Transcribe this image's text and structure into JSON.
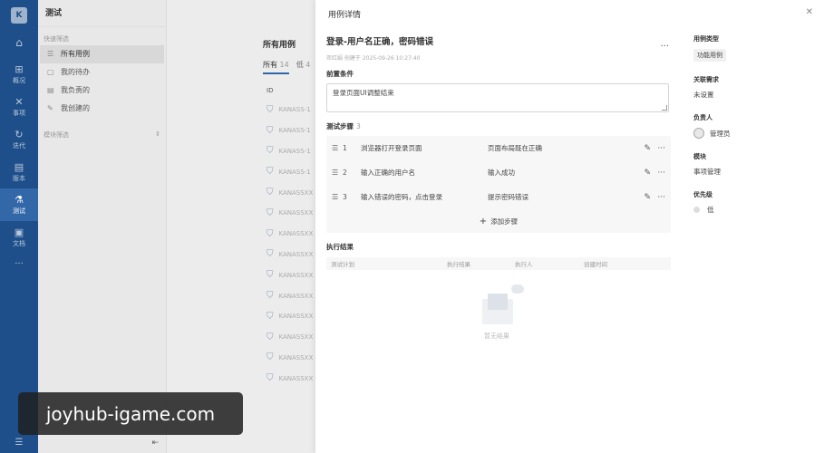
{
  "nav": {
    "logo": "K",
    "items": [
      {
        "label": "概况",
        "icon": "grid-icon"
      },
      {
        "label": "事项",
        "icon": "issue-icon"
      },
      {
        "label": "迭代",
        "icon": "iteration-icon"
      },
      {
        "label": "版本",
        "icon": "version-icon"
      },
      {
        "label": "测试",
        "icon": "test-icon",
        "active": true
      },
      {
        "label": "文档",
        "icon": "doc-icon"
      }
    ],
    "more": "···"
  },
  "sidebar": {
    "title": "测试",
    "quick_filter": "快速筛选",
    "items": [
      {
        "label": "所有用例",
        "active": true
      },
      {
        "label": "我的待办"
      },
      {
        "label": "我负责的"
      },
      {
        "label": "我创建的"
      }
    ],
    "module_filter": "模块筛选"
  },
  "list": {
    "title": "所有用例",
    "tabs": [
      {
        "label": "所有",
        "count": "14"
      },
      {
        "label": "低",
        "count": "4"
      }
    ],
    "col_id": "ID",
    "rows": [
      "KANASS-1",
      "KANASS-1",
      "KANASS-1",
      "KANASS-1",
      "KANASSXX",
      "KANASSXX",
      "KANASSXX",
      "KANASSXX",
      "KANASSXX",
      "KANASSXX",
      "KANASSXX",
      "KANASSXX",
      "KANASSXX",
      "KANASSXX"
    ]
  },
  "drawer": {
    "title": "用例详情",
    "case_title": "登录-用户名正确，密码错误",
    "meta": "邓红娟 创建于 2025-09-26 10:27:40",
    "precond_label": "前置条件",
    "precond_value": "登录页面UI调整结束",
    "steps_label": "测试步骤",
    "steps_count": "3",
    "steps": [
      {
        "num": "1",
        "desc": "浏览器打开登录页面",
        "expect": "页面布局既在正确"
      },
      {
        "num": "2",
        "desc": "输入正确的用户名",
        "expect": "输入成功"
      },
      {
        "num": "3",
        "desc": "输入错误的密码，点击登录",
        "expect": "提示密码错误"
      }
    ],
    "add_step": "添加步骤",
    "exec_label": "执行结果",
    "exec_cols": [
      "测试计划",
      "执行结果",
      "执行人",
      "创建时间"
    ],
    "empty_text": "暂无结果"
  },
  "props": {
    "type_label": "用例类型",
    "type_value": "功能用例",
    "req_label": "关联需求",
    "req_value": "未设置",
    "owner_label": "负责人",
    "owner_value": "管理员",
    "module_label": "模块",
    "module_value": "事项管理",
    "prio_label": "优先级",
    "prio_value": "低"
  },
  "watermark": "joyhub-igame.com"
}
